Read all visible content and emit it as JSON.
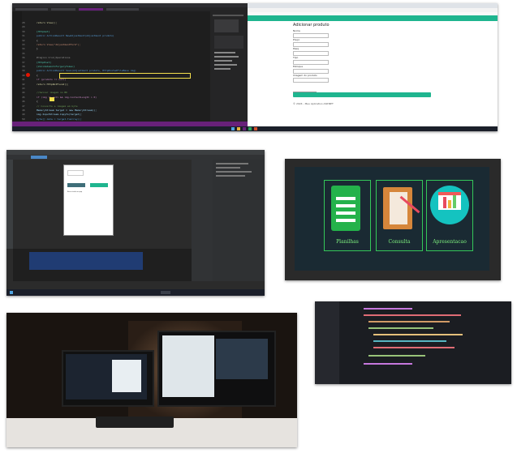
{
  "collage": {
    "colors": {
      "ide_dark": "#1e1e1e",
      "ide_panel": "#252526",
      "taskbar": "#1b1f2a",
      "accent_teal": "#1fb58f",
      "vs_purple": "#68217a",
      "breakpoint_red": "#e51400",
      "highlight_yellow": "#f4e04d",
      "selection_blue": "#264f78"
    }
  },
  "shot1": {
    "code_lines": [
      "return View();",
      "",
      "[HttpGet]",
      "public ActionResult NewAdjustment(Adjustment produto)",
      "{",
      "   return View(\"AdjustmentForm\");",
      "}",
      "",
      "#region Crud_Operations",
      "[HttpPost]",
      "[ValidateAntiForgeryToken]",
      "public ActionResult Save(Adjustment produto, HttpPostedFileBase img)",
      "{",
      "   if (produto != null)",
      "      return HttpNotFound();",
      "",
      "   //Salvar imagem no BD",
      "   if (img != null && img.ContentLength > 0)",
      "   {",
      "      // Converte a imagem em byte",
      "      MemoryStream target = new MemoryStream();",
      "      img.InputStream.CopyTo(target);",
      "      byte[] data = target.ToArray();"
    ],
    "line_numbers": [
      "28",
      "29",
      "30",
      "31",
      "32",
      "33",
      "34",
      "35",
      "36",
      "37",
      "38",
      "39",
      "40",
      "41",
      "42",
      "43",
      "44",
      "45",
      "46",
      "47",
      "48",
      "49",
      "50"
    ],
    "browser": {
      "nav_items": [
        "Nome do aplicativo",
        "Produtos",
        "Ajustes",
        "Privacidade"
      ],
      "right_nav": [
        "Registrar",
        "Logon"
      ],
      "title": "Adicionar produto",
      "fields": [
        "Nome",
        "Preço",
        "Pesq",
        "Tipo",
        "Estoque",
        "Imagem do produto"
      ],
      "file_button": "Escolher arquivo",
      "file_name": "lamp_cactus.jpg",
      "save_label": "Salvar",
      "footer": "© 2024 - Meu Aplicativo ASP.NET"
    }
  },
  "shot2": {
    "phone": {
      "left_button": "Cadastrar",
      "right_button": "Entrar",
      "text": "Bem-vindo ao app"
    }
  },
  "shot3": {
    "tiles": [
      {
        "label": "Planilhas",
        "icon": "spreadsheet-icon"
      },
      {
        "label": "Consulta",
        "icon": "notebook-pencil-icon"
      },
      {
        "label": "Apresentacao",
        "icon": "presentation-chart-icon"
      }
    ]
  },
  "shot4": {
    "description_icons": [
      "dual-monitor-desk",
      "keyboard"
    ]
  }
}
